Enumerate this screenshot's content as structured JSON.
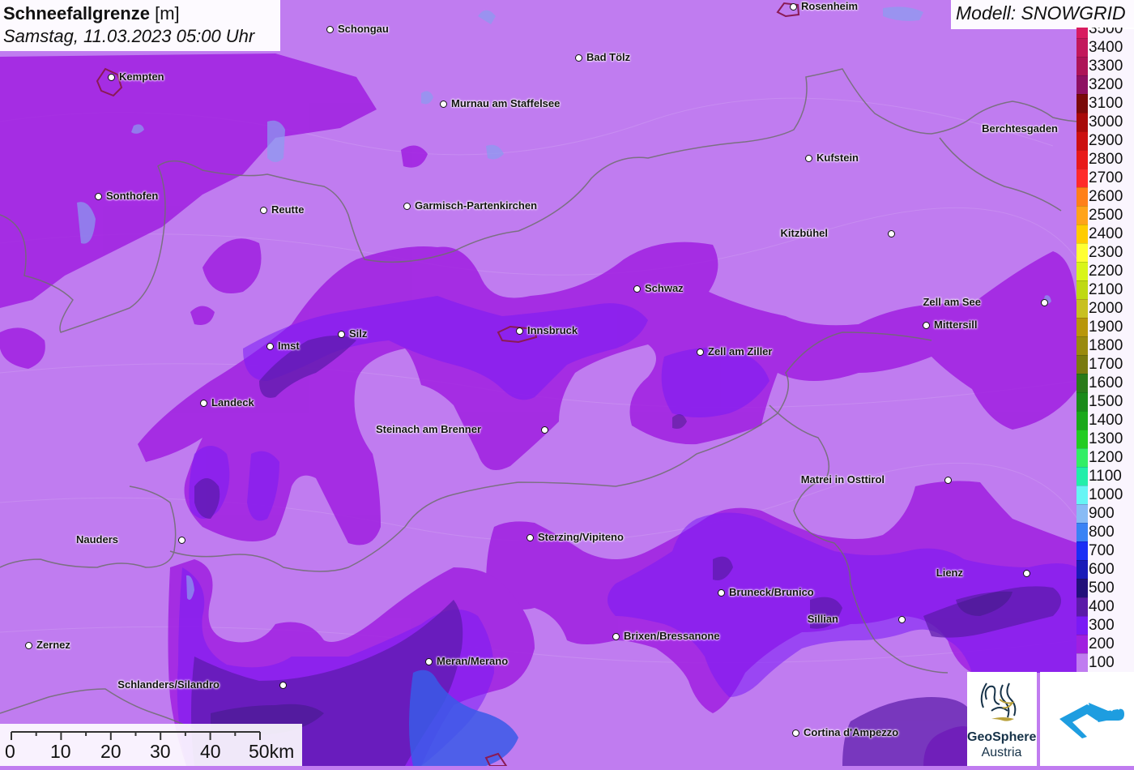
{
  "title": {
    "main": "Schneefallgrenze",
    "unit": "[m]",
    "datetime": "Samstag, 11.03.2023 05:00 Uhr"
  },
  "model": "Modell: SNOWGRID",
  "legend": [
    {
      "label": "3500",
      "color": "#d81b60"
    },
    {
      "label": "3400",
      "color": "#c2185b"
    },
    {
      "label": "3300",
      "color": "#ad1457"
    },
    {
      "label": "3200",
      "color": "#8e1062"
    },
    {
      "label": "3100",
      "color": "#7a0a0a"
    },
    {
      "label": "3000",
      "color": "#a80a0a"
    },
    {
      "label": "2900",
      "color": "#cc1010"
    },
    {
      "label": "2800",
      "color": "#e81a1a"
    },
    {
      "label": "2700",
      "color": "#ff2a2a"
    },
    {
      "label": "2600",
      "color": "#ff7f1a"
    },
    {
      "label": "2500",
      "color": "#ffa31a"
    },
    {
      "label": "2400",
      "color": "#ffcc00"
    },
    {
      "label": "2300",
      "color": "#ffff33"
    },
    {
      "label": "2200",
      "color": "#d9f51a"
    },
    {
      "label": "2100",
      "color": "#bfd914"
    },
    {
      "label": "2000",
      "color": "#c8c020"
    },
    {
      "label": "1900",
      "color": "#b8960a"
    },
    {
      "label": "1800",
      "color": "#9a8a0e"
    },
    {
      "label": "1700",
      "color": "#7a7a10"
    },
    {
      "label": "1600",
      "color": "#2a7a1a"
    },
    {
      "label": "1500",
      "color": "#1a8a1a"
    },
    {
      "label": "1400",
      "color": "#1aa81a"
    },
    {
      "label": "1300",
      "color": "#22cc22"
    },
    {
      "label": "1200",
      "color": "#33ee66"
    },
    {
      "label": "1100",
      "color": "#22eeaa"
    },
    {
      "label": "1000",
      "color": "#66f5f5"
    },
    {
      "label": "900",
      "color": "#88bbf5"
    },
    {
      "label": "800",
      "color": "#3a82f5"
    },
    {
      "label": "700",
      "color": "#1a2ef5"
    },
    {
      "label": "600",
      "color": "#1a1ab8"
    },
    {
      "label": "500",
      "color": "#22107a"
    },
    {
      "label": "400",
      "color": "#5a1aa8"
    },
    {
      "label": "300",
      "color": "#7a1af5"
    },
    {
      "label": "200",
      "color": "#a020e0"
    },
    {
      "label": "100",
      "color": "#c07cf0"
    }
  ],
  "cities": [
    {
      "name": "Rosenheim",
      "side": "right"
    },
    {
      "name": "Schongau",
      "side": "right"
    },
    {
      "name": "Bad Tölz",
      "side": "right"
    },
    {
      "name": "Kempten",
      "side": "right"
    },
    {
      "name": "Murnau am Staffelsee",
      "side": "right"
    },
    {
      "name": "Berchtesgaden",
      "side": "left"
    },
    {
      "name": "Kufstein",
      "side": "right"
    },
    {
      "name": "Sonthofen",
      "side": "right"
    },
    {
      "name": "Reutte",
      "side": "right"
    },
    {
      "name": "Garmisch-Partenkirchen",
      "side": "right"
    },
    {
      "name": "Kitzbühel",
      "side": "left"
    },
    {
      "name": "Schwaz",
      "side": "right"
    },
    {
      "name": "Zell am See",
      "side": "left"
    },
    {
      "name": "Mittersill",
      "side": "right"
    },
    {
      "name": "Innsbruck",
      "side": "right"
    },
    {
      "name": "Silz",
      "side": "right"
    },
    {
      "name": "Imst",
      "side": "right"
    },
    {
      "name": "Zell am Ziller",
      "side": "right"
    },
    {
      "name": "Landeck",
      "side": "right"
    },
    {
      "name": "Steinach am Brenner",
      "side": "left"
    },
    {
      "name": "Matrei in Osttirol",
      "side": "left"
    },
    {
      "name": "Nauders",
      "side": "left"
    },
    {
      "name": "Sterzing/Vipiteno",
      "side": "right"
    },
    {
      "name": "Lienz",
      "side": "left"
    },
    {
      "name": "Bruneck/Brunico",
      "side": "right"
    },
    {
      "name": "Sillian",
      "side": "left"
    },
    {
      "name": "Brixen/Bressanone",
      "side": "right"
    },
    {
      "name": "Zernez",
      "side": "right"
    },
    {
      "name": "Meran/Merano",
      "side": "right"
    },
    {
      "name": "Schlanders/Silandro",
      "side": "left"
    },
    {
      "name": "Cortina d'Ampezzo",
      "side": "right"
    }
  ],
  "scalebar": {
    "ticks": [
      "0",
      "10",
      "20",
      "30",
      "40",
      "50km"
    ]
  },
  "logos": {
    "geosphere": {
      "line1": "GeoSphere",
      "line2": "Austria",
      "color": "#163248"
    },
    "partner": {
      "icon": "cloud-mountain-icon",
      "color": "#1e9de0"
    }
  },
  "colors": {
    "base": "#c07cf0",
    "level200": "#a020e0",
    "level300": "#7a1af5",
    "level400": "#5a1aa8",
    "level800": "#3a82f5",
    "border": "#6e6e6e"
  }
}
